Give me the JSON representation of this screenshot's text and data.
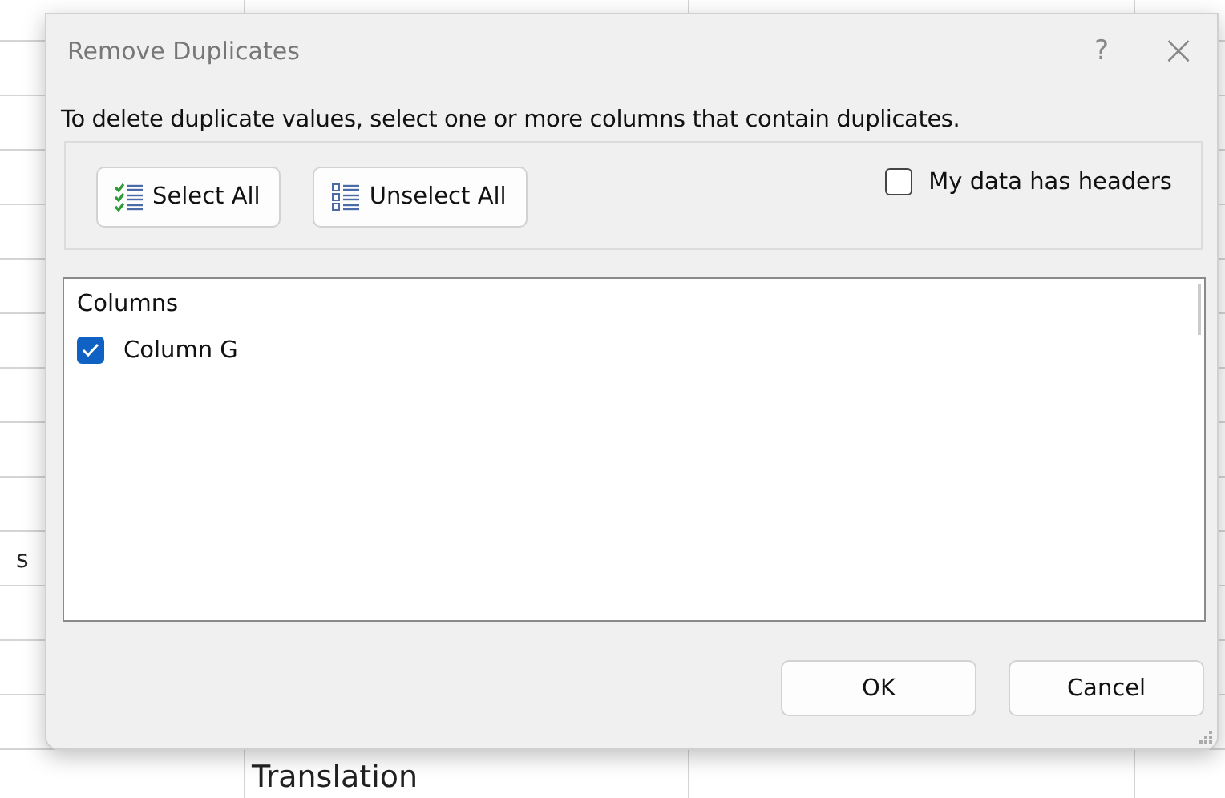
{
  "sheet": {
    "left_cell": "s",
    "bottom_cell": "Translation"
  },
  "dialog": {
    "title": "Remove Duplicates",
    "help": "?",
    "close": "×",
    "instruction": "To delete duplicate values, select one or more columns that contain duplicates.",
    "select_all": "Select All",
    "unselect_all": "Unselect All",
    "headers_checkbox": {
      "label": "My data has headers",
      "checked": false
    },
    "columns_header": "Columns",
    "columns": [
      {
        "label": "Column G",
        "checked": true
      }
    ],
    "ok_button": "OK",
    "cancel_button": "Cancel"
  }
}
